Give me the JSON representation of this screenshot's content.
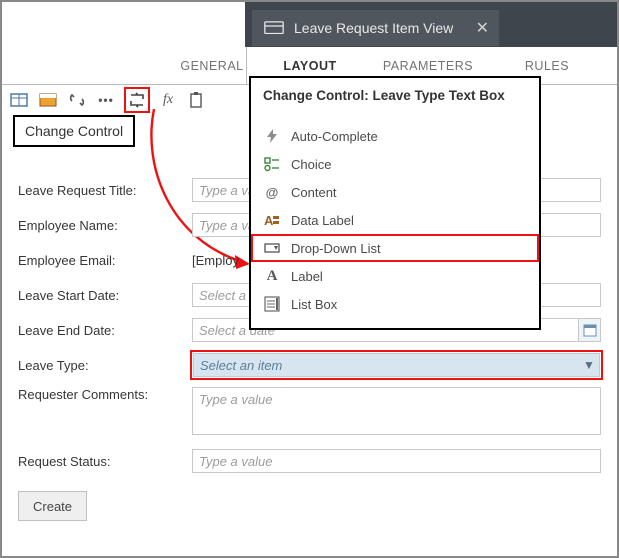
{
  "header": {
    "tab_title": "Leave Request Item View"
  },
  "section_tabs": {
    "general": "GENERAL",
    "layout": "LAYOUT",
    "parameters": "PARAMETERS",
    "rules": "RULES"
  },
  "callout": {
    "label": "Change Control"
  },
  "form": {
    "placeholders": {
      "type_value": "Type a value",
      "select_date": "Select a date",
      "select_item": "Select an item"
    },
    "rows": {
      "title": {
        "label": "Leave Request Title:"
      },
      "emp_name": {
        "label": "Employee Name:"
      },
      "emp_email": {
        "label": "Employee Email:",
        "value": "[Employ"
      },
      "start": {
        "label": "Leave Start Date:"
      },
      "end": {
        "label": "Leave End Date:"
      },
      "type": {
        "label": "Leave Type:"
      },
      "comments": {
        "label": "Requester Comments:"
      },
      "status": {
        "label": "Request Status:"
      }
    },
    "create": "Create"
  },
  "change_control": {
    "title": "Change Control: Leave Type Text Box",
    "options": {
      "auto": "Auto-Complete",
      "choice": "Choice",
      "content": "Content",
      "datalbl": "Data Label",
      "ddl": "Drop-Down List",
      "label": "Label",
      "listbox": "List Box"
    }
  }
}
